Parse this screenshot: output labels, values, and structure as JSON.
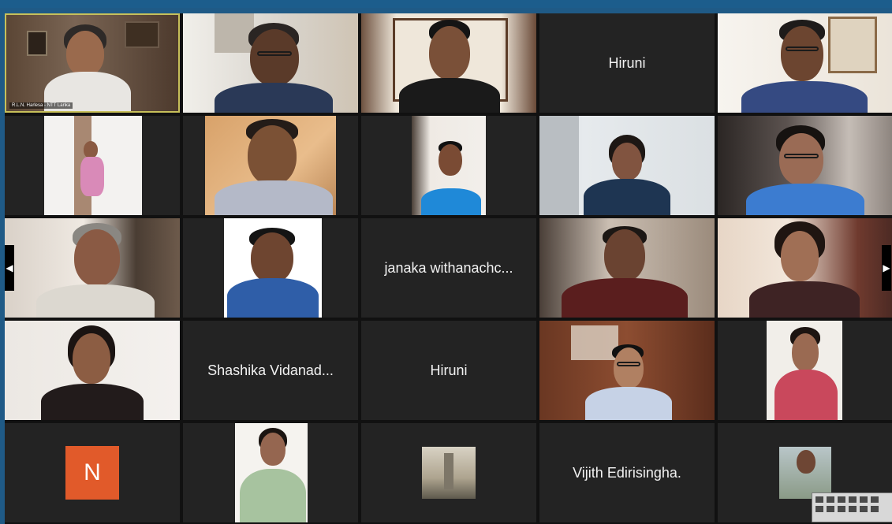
{
  "meeting": {
    "active_speaker_label": "R.L.N. Harlesa - NTT Lanka"
  },
  "name_tiles": {
    "hiruni_top": "Hiruni",
    "janaka": "janaka withanachc...",
    "shashika": "Shashika Vidanad...",
    "hiruni_mid": "Hiruni",
    "vijith": "Vijith Edirisingha."
  },
  "avatar": {
    "initial": "N",
    "color": "#e15a2a"
  },
  "icons": {
    "left_arrow": "◀",
    "right_arrow": "▶"
  },
  "colors": {
    "frame": "#1f5a86",
    "tile_bg": "#232323",
    "active_border": "#c7c05a"
  }
}
